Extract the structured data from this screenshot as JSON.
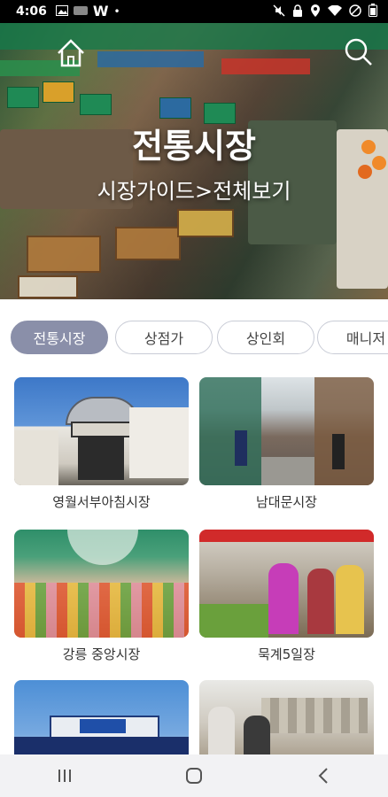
{
  "status_bar": {
    "time": "4:06",
    "left_icons": [
      "image-icon",
      "kakao-icon",
      "w-app-icon",
      "dot-icon"
    ],
    "right_icons": [
      "mute-icon",
      "lock-icon",
      "location-icon",
      "wifi-icon",
      "no-entry-icon",
      "battery-icon"
    ]
  },
  "hero": {
    "title": "전통시장",
    "subtitle": "시장가이드>전체보기"
  },
  "tabs": [
    {
      "label": "전통시장",
      "active": true
    },
    {
      "label": "상점가",
      "active": false
    },
    {
      "label": "상인회",
      "active": false
    },
    {
      "label": "매니저",
      "active": false
    }
  ],
  "markets": [
    {
      "name": "영월서부아침시장"
    },
    {
      "name": "남대문시장"
    },
    {
      "name": "강릉 중앙시장"
    },
    {
      "name": "묵계5일장"
    },
    {
      "name": ""
    },
    {
      "name": ""
    }
  ],
  "colors": {
    "active_tab": "#8a8fa9",
    "tab_border": "#c9ccd6",
    "status_bar": "#000000",
    "nav_bar": "#f2f2f4"
  }
}
